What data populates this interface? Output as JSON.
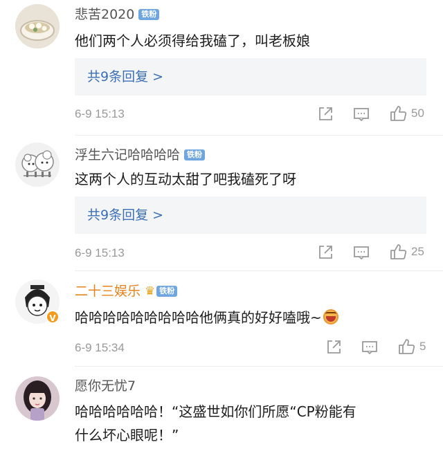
{
  "comments": [
    {
      "user": "悲苦2020",
      "badge": "铁粉",
      "text": "他们两个人必须得给我磕了，叫老板娘",
      "replies": "共9条回复 >",
      "time": "6-9 15:13",
      "likes": "50",
      "avatar_icon": "avatar-food-bowl"
    },
    {
      "user": "浮生六记哈哈哈哈",
      "badge": "铁粉",
      "text": "这两个人的互动太甜了吧我磕死了呀",
      "replies": "共9条回复 >",
      "time": "6-9 15:13",
      "likes": "25",
      "avatar_icon": "avatar-sheep"
    },
    {
      "user": "二十三娱乐",
      "badge": "铁粉",
      "text": "哈哈哈哈哈哈哈哈哈他俩真的好好嗑哦~",
      "time": "6-9 15:34",
      "likes": "5",
      "avatar_icon": "avatar-cartoon-vip",
      "vip_badge": "V"
    },
    {
      "user": "愿你无忧7",
      "text_line1": "哈哈哈哈哈哈！“这盛世如你们所愿“CP粉能有",
      "text_line2": "什么坏心眼呢！”",
      "avatar_icon": "avatar-girl-photo"
    }
  ],
  "icons": {
    "share": "share-icon",
    "comment": "comment-icon",
    "like": "thumbs-up-icon"
  },
  "colors": {
    "link": "#3b6fb3",
    "badge": "#6fa6df",
    "vip_name": "#e8821b",
    "meta": "#999999"
  }
}
